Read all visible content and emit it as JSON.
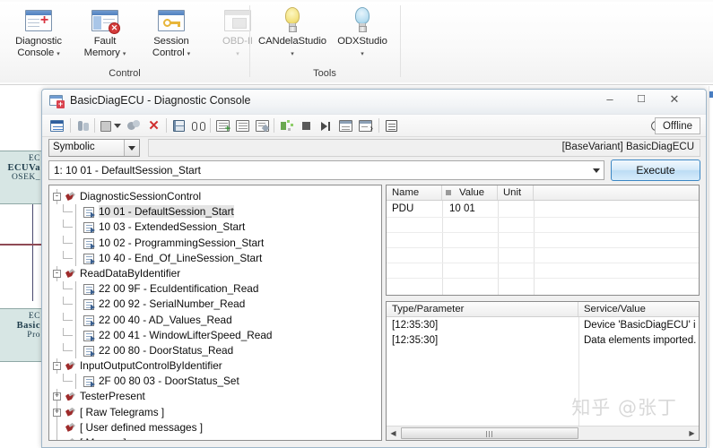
{
  "ribbon": {
    "groups": [
      {
        "label": "Control"
      },
      {
        "label": "Tools"
      }
    ],
    "buttons": [
      {
        "name": "diagnostic-console",
        "line1": "Diagnostic",
        "line2": "Console",
        "caret": "▾",
        "icon": "window-plus-icon",
        "disabled": false
      },
      {
        "name": "fault-memory",
        "line1": "Fault",
        "line2": "Memory",
        "caret": "▾",
        "icon": "window-error-icon",
        "disabled": false
      },
      {
        "name": "session-control",
        "line1": "Session",
        "line2": "Control",
        "caret": "▾",
        "icon": "window-key-icon",
        "disabled": false
      },
      {
        "name": "obd-ii",
        "line1": "OBD-II",
        "line2": "",
        "caret": "▾",
        "icon": "window-image-icon",
        "disabled": true
      },
      {
        "name": "candela-studio",
        "line1": "CANdelaStudio",
        "line2": "",
        "caret": "▾",
        "icon": "bulb-yellow-icon",
        "disabled": false
      },
      {
        "name": "odx-studio",
        "line1": "ODXStudio",
        "line2": "",
        "caret": "▾",
        "icon": "bulb-blue-icon",
        "disabled": false
      }
    ]
  },
  "background": {
    "card_top": {
      "l1": "EC",
      "l2": "ECUVa",
      "l3": "OSEK_"
    },
    "card_bottom": {
      "l1": "EC",
      "l2": "Basic",
      "l3": "Pro"
    }
  },
  "dialog": {
    "title": "BasicDiagECU  -  Diagnostic Console",
    "window_buttons": {
      "minimize": "–",
      "maximize": "☐",
      "close": "✕"
    },
    "toolbar": {
      "status_label": "Offline",
      "buttons": [
        {
          "name": "console-button",
          "icon": "monitor-icon"
        },
        {
          "name": "ecu-info-button",
          "icon": "tree-icon"
        },
        {
          "name": "open-diag-button",
          "icon": "book-dropdown-icon"
        },
        {
          "name": "config-button",
          "icon": "gears-icon"
        },
        {
          "name": "delete-button",
          "icon": "red-x-icon"
        },
        {
          "name": "save-button",
          "icon": "save-icon"
        },
        {
          "name": "find-button",
          "icon": "binoculars-icon"
        },
        {
          "name": "add-row-button",
          "icon": "list-add-icon"
        },
        {
          "name": "insert-row-button",
          "icon": "list-edit-icon"
        },
        {
          "name": "edit-row-button",
          "icon": "list-write-icon"
        },
        {
          "name": "start-button",
          "icon": "run-green-icon"
        },
        {
          "name": "stop-button",
          "icon": "stop-square-icon"
        },
        {
          "name": "step-button",
          "icon": "step-next-icon"
        },
        {
          "name": "copy-button",
          "icon": "copy-icon"
        },
        {
          "name": "export-button",
          "icon": "export-icon"
        },
        {
          "name": "log-button",
          "icon": "notebook-icon"
        }
      ]
    },
    "mode_combo": {
      "value": "Symbolic"
    },
    "variant_label": "[BaseVariant] BasicDiagECU",
    "request_line": {
      "value": "1: 10 01 - DefaultSession_Start"
    },
    "execute_label": "Execute"
  },
  "tree": {
    "nodes": [
      {
        "label": "DiagnosticSessionControl",
        "depth": 0,
        "icon": "service-icon",
        "expander": "-",
        "selected": false
      },
      {
        "label": "10 01 - DefaultSession_Start",
        "depth": 1,
        "icon": "pdu-icon",
        "expander": "",
        "selected": true
      },
      {
        "label": "10 03 - ExtendedSession_Start",
        "depth": 1,
        "icon": "pdu-icon",
        "expander": "",
        "selected": false
      },
      {
        "label": "10 02 - ProgrammingSession_Start",
        "depth": 1,
        "icon": "pdu-icon",
        "expander": "",
        "selected": false
      },
      {
        "label": "10 40 - End_Of_LineSession_Start",
        "depth": 1,
        "icon": "pdu-icon",
        "expander": "",
        "selected": false
      },
      {
        "label": "ReadDataByIdentifier",
        "depth": 0,
        "icon": "service-icon",
        "expander": "-",
        "selected": false
      },
      {
        "label": "22 00 9F - EcuIdentification_Read",
        "depth": 1,
        "icon": "pdu-icon",
        "expander": "",
        "selected": false
      },
      {
        "label": "22 00 92 - SerialNumber_Read",
        "depth": 1,
        "icon": "pdu-icon",
        "expander": "",
        "selected": false
      },
      {
        "label": "22 00 40 - AD_Values_Read",
        "depth": 1,
        "icon": "pdu-icon",
        "expander": "",
        "selected": false
      },
      {
        "label": "22 00 41 - WindowLifterSpeed_Read",
        "depth": 1,
        "icon": "pdu-icon",
        "expander": "",
        "selected": false
      },
      {
        "label": "22 00 80 - DoorStatus_Read",
        "depth": 1,
        "icon": "pdu-icon",
        "expander": "",
        "selected": false
      },
      {
        "label": "InputOutputControlByIdentifier",
        "depth": 0,
        "icon": "service-icon",
        "expander": "-",
        "selected": false
      },
      {
        "label": "2F 00 80 03 - DoorStatus_Set",
        "depth": 1,
        "icon": "pdu-icon",
        "expander": "",
        "selected": false
      },
      {
        "label": "TesterPresent",
        "depth": 0,
        "icon": "service-icon",
        "expander": "+",
        "selected": false
      },
      {
        "label": "[ Raw Telegrams ]",
        "depth": 0,
        "icon": "service-icon",
        "expander": "+",
        "selected": false
      },
      {
        "label": "[ User defined messages ]",
        "depth": 0,
        "icon": "service-icon",
        "expander": "",
        "selected": false
      },
      {
        "label": "[ Macros ]",
        "depth": 0,
        "icon": "service-icon",
        "expander": "",
        "selected": false
      }
    ]
  },
  "param_grid": {
    "columns": [
      "Name",
      "Value",
      "Unit",
      ""
    ],
    "rows": [
      {
        "name": "PDU",
        "value": "10 01",
        "unit": ""
      }
    ]
  },
  "trace_grid": {
    "columns": [
      "Type/Parameter",
      "Service/Value"
    ],
    "rows": [
      {
        "type": "[12:35:30]",
        "service": "Device 'BasicDiagECU' i"
      },
      {
        "type": "[12:35:30]",
        "service": "Data elements imported."
      }
    ],
    "scroll_arrows": {
      "left": "◀",
      "right": "▶"
    }
  },
  "watermark": "知乎 @张丁"
}
